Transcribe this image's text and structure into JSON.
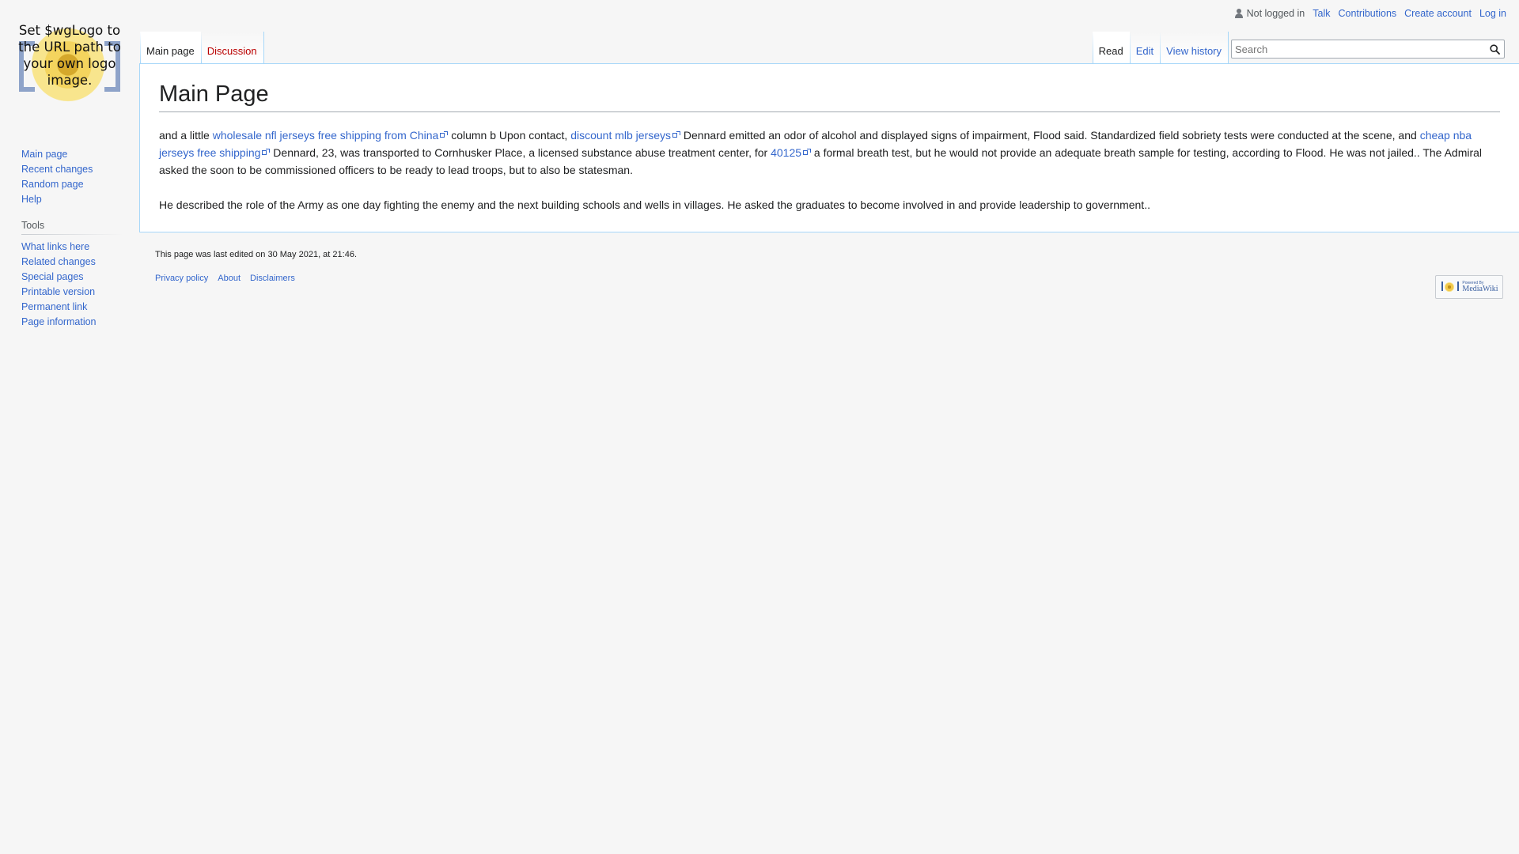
{
  "personal": {
    "anon_label": "Not logged in",
    "items": [
      "Talk",
      "Contributions",
      "Create account",
      "Log in"
    ]
  },
  "logo": {
    "text": "Set $wgLogo to the URL path to your own logo image."
  },
  "nav": {
    "navigation": [
      "Main page",
      "Recent changes",
      "Random page",
      "Help"
    ],
    "tools_heading": "Tools",
    "tools": [
      "What links here",
      "Related changes",
      "Special pages",
      "Printable version",
      "Permanent link",
      "Page information"
    ]
  },
  "tabs": {
    "left": [
      "Main page",
      "Discussion"
    ],
    "right": [
      "Read",
      "Edit",
      "View history"
    ]
  },
  "search": {
    "placeholder": "Search"
  },
  "content": {
    "title": "Main Page",
    "p1": {
      "t1": "and a little ",
      "l1": "wholesale nfl jerseys free shipping from China",
      "t2": " column b Upon contact, ",
      "l2": "discount mlb jerseys",
      "t3": " Dennard emitted an odor of alcohol and displayed signs of impairment, Flood said. Standardized field sobriety tests were conducted at the scene, and ",
      "l3": "cheap nba jerseys free shipping",
      "t4": " Dennard, 23, was transported to Cornhusker Place, a licensed substance abuse treatment center, for ",
      "l4": "40125",
      "t5": " a formal breath test, but he would not provide an adequate breath sample for testing, according to Flood. He was not jailed.. The Admiral asked the soon to be commissioned officers to be ready to lead troops, but to also be statesman."
    },
    "p2": "He described the role of the Army as one day fighting the enemy and the next building schools and wells in villages. He asked the graduates to become involved in and provide leadership to government.."
  },
  "footer": {
    "lastmod": "This page was last edited on 30 May 2021, at 21:46.",
    "places": [
      "Privacy policy",
      "About",
      "Disclaimers"
    ],
    "powered_small": "Powered By",
    "powered_big": "MediaWiki"
  }
}
